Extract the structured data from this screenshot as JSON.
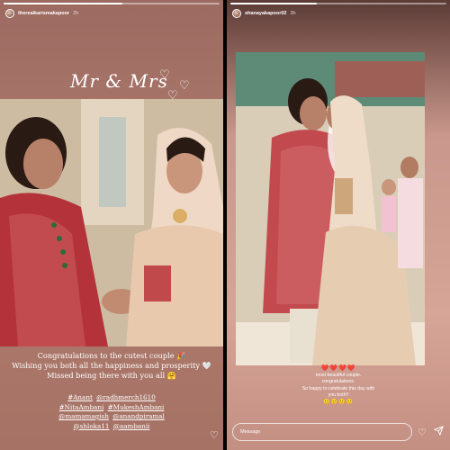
{
  "left_story": {
    "username": "therealkarismakapoor",
    "time": "2h",
    "progress": 0.55,
    "title_script": "Mr & Mrs",
    "caption_lines": [
      "Congratulations to the cutest couple 🎉",
      "Wishing you both all the happiness and prosperity 🤍",
      "Missed being there with you all 🤗"
    ],
    "tags": [
      "#Anant",
      "@radhmerch1610",
      "#NitaAmbani",
      "#MukeshAmbani",
      "@mamamagish",
      "@anandpiramal",
      "@shloka11",
      "@aambanii"
    ],
    "icons": {
      "avatar": "avatar-icon",
      "heart": "heart-outline-icon",
      "title_hearts": "heart-outline-icon"
    }
  },
  "right_story": {
    "username": "shanayakapoor02",
    "time": "3h",
    "progress": 0.4,
    "hearts": "❤️❤️❤️❤️",
    "message_lines": [
      "most beautiful couple.",
      "congratulations.",
      "So happy to celebrate this day with",
      "you both!!"
    ],
    "emoji_row": "🙂🙂🙂🙂",
    "message_placeholder": "Message",
    "icons": {
      "heart": "heart-outline-icon",
      "send": "send-icon"
    }
  }
}
